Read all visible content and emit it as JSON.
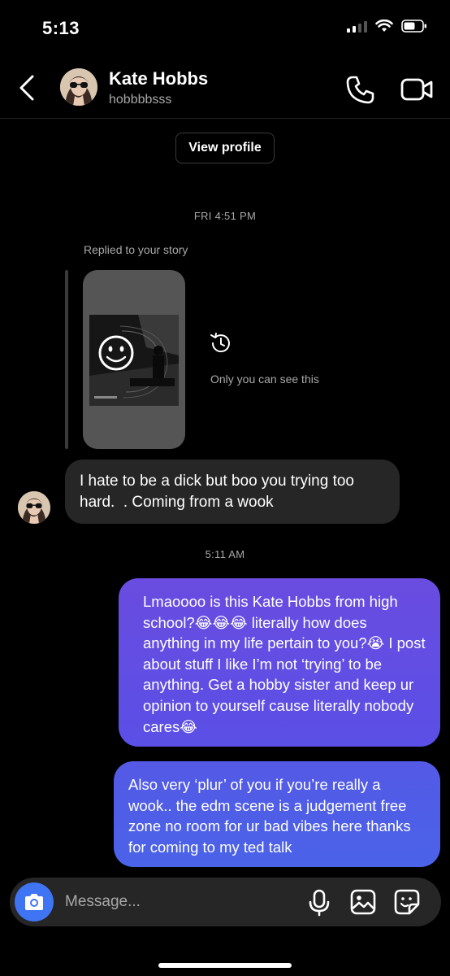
{
  "status_bar": {
    "time": "5:13"
  },
  "header": {
    "name": "Kate Hobbs",
    "handle": "hobbbbsss"
  },
  "view_profile_label": "View profile",
  "thread": {
    "timestamp_1": "FRI 4:51 PM",
    "replied_label": "Replied to your story",
    "story_note": "Only you can see this",
    "incoming_message": "I hate to be a dick but boo you trying too hard.  . Coming from a wook",
    "timestamp_2": "5:11 AM",
    "outgoing_message_1": "Lmaoooo is this Kate Hobbs from high school?😂😂😂 literally how does anything in my life pertain to you?😭 I post about stuff I like I’m not ‘trying’ to be anything. Get a hobby sister and keep ur opinion to yourself cause literally nobody cares😂",
    "outgoing_message_2": "Also very ‘plur’ of you if you’re really a wook.. the edm scene is a judgement free zone no room for ur bad vibes here thanks for coming to my ted talk"
  },
  "composer": {
    "placeholder": "Message..."
  },
  "icons": [
    "back-arrow-icon",
    "phone-icon",
    "video-camera-icon",
    "history-icon",
    "camera-icon",
    "microphone-icon",
    "gallery-icon",
    "sticker-icon"
  ],
  "colors": {
    "background": "#000000",
    "incoming_bubble": "#262626",
    "outgoing_bubble": "#5a4fe6",
    "camera_button": "#3f74f2"
  }
}
